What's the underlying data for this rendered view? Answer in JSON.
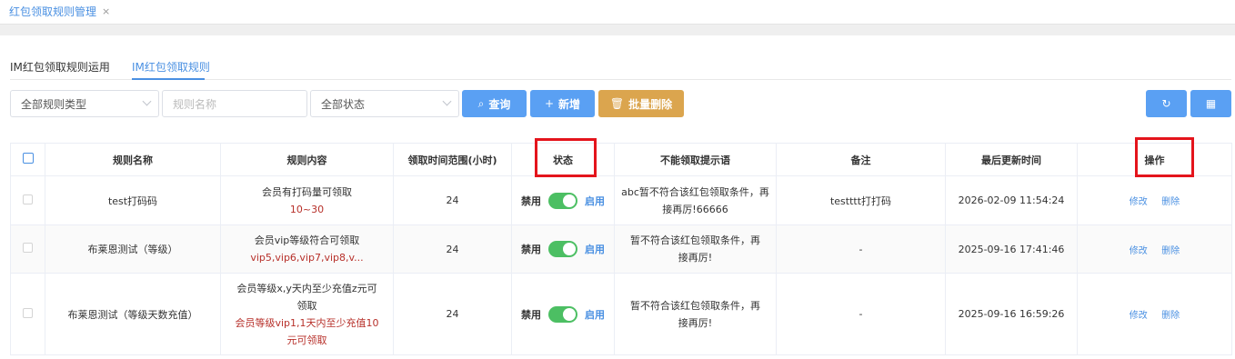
{
  "top_tab": {
    "label": "红包领取规则管理",
    "close": "×"
  },
  "sub_tabs": [
    {
      "label": "IM红包领取规则运用"
    },
    {
      "label": "IM红包领取规则"
    }
  ],
  "toolbar": {
    "rule_type_select": "全部规则类型",
    "rule_name_placeholder": "规则名称",
    "status_select": "全部状态",
    "query_label": "查询",
    "add_label": "新增",
    "batch_delete_label": "批量删除"
  },
  "table": {
    "headers": [
      "规则名称",
      "规则内容",
      "领取时间范围(小时)",
      "状态",
      "不能领取提示语",
      "备注",
      "最后更新时间",
      "操作"
    ],
    "rows": [
      {
        "name": "test打码码",
        "content_line1": "会员有打码量可领取",
        "content_line2": "10~30",
        "hours": "24",
        "status_off": "禁用",
        "status_on": "启用",
        "tip": "abc暂不符合该红包领取条件，再接再厉!66666",
        "remark": "testttt打打码",
        "updated": "2026-02-09 11:54:24",
        "edit": "修改",
        "delete": "删除"
      },
      {
        "name": "布莱恩测试（等级）",
        "content_line1": "会员vip等级符合可领取",
        "content_line2": "vip5,vip6,vip7,vip8,v...",
        "hours": "24",
        "status_off": "禁用",
        "status_on": "启用",
        "tip": "暂不符合该红包领取条件，再接再厉!",
        "remark": "-",
        "updated": "2025-09-16 17:41:46",
        "edit": "修改",
        "delete": "删除"
      },
      {
        "name": "布莱恩测试（等级天数充值）",
        "content_line1": "会员等级x,y天内至少充值z元可领取",
        "content_line2": "会员等级vip1,1天内至少充值10元可领取",
        "hours": "24",
        "status_off": "禁用",
        "status_on": "启用",
        "tip": "暂不符合该红包领取条件，再接再厉!",
        "remark": "-",
        "updated": "2025-09-16 16:59:26",
        "edit": "修改",
        "delete": "删除"
      }
    ]
  },
  "colors": {
    "accent": "#4a90e2",
    "switch_on": "#4cbf63",
    "gold": "#dba54e",
    "highlight": "#e4141c"
  }
}
